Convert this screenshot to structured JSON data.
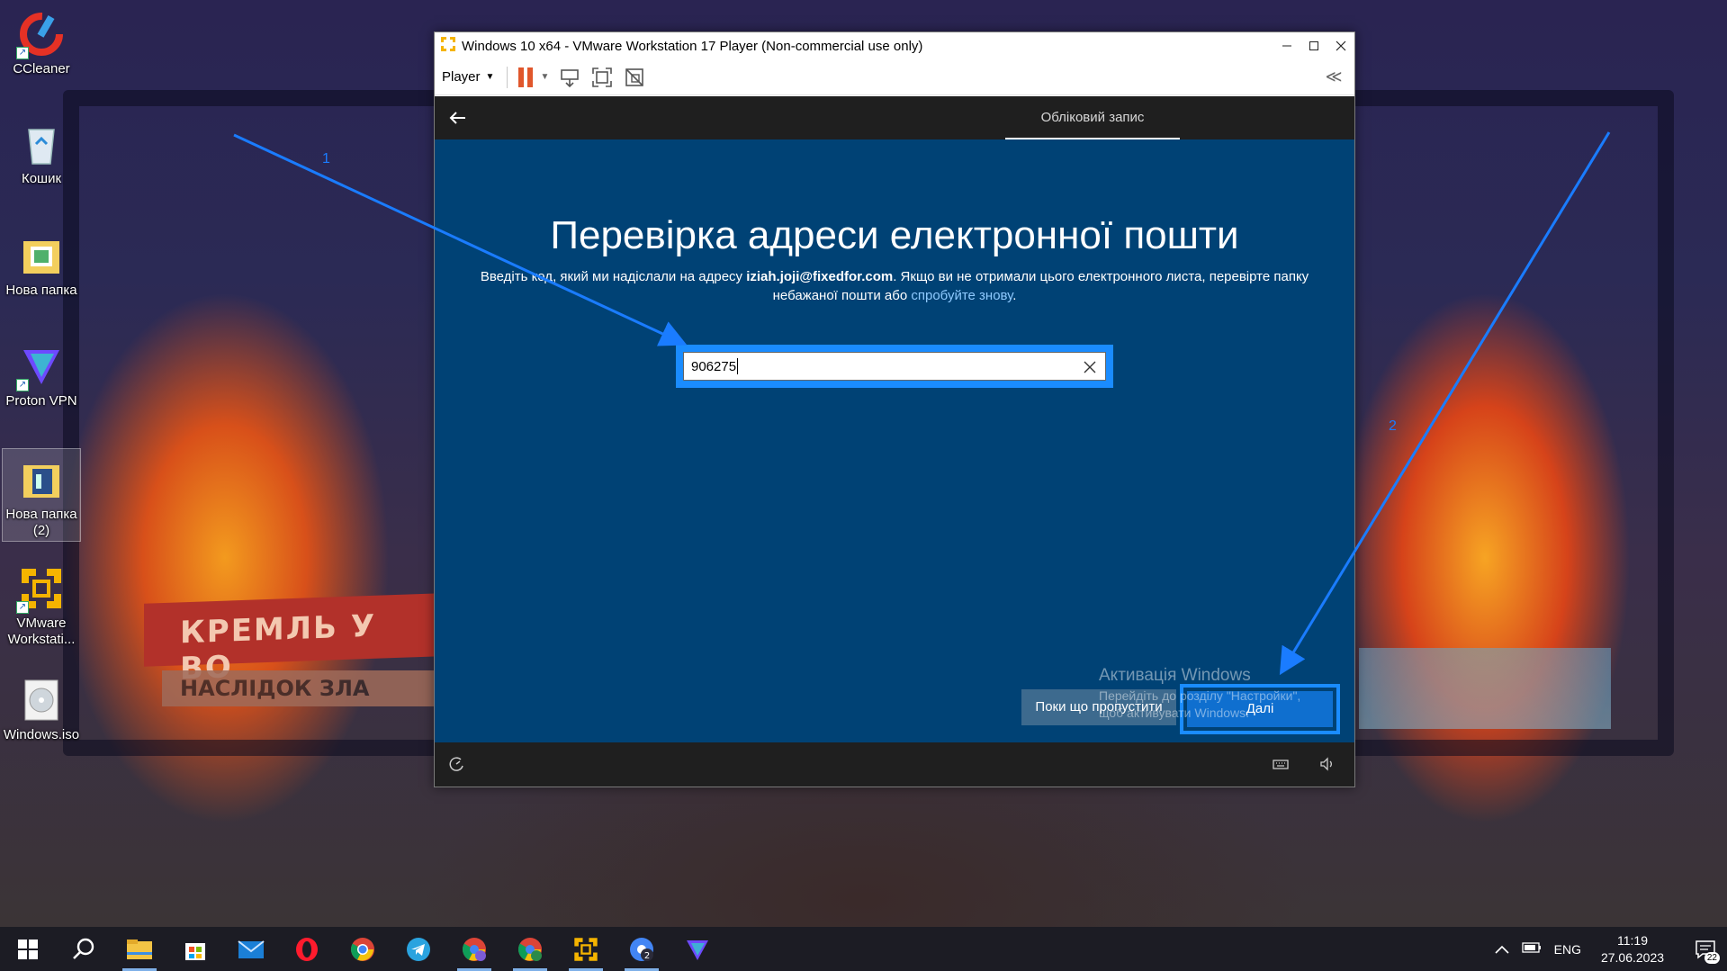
{
  "desktop": {
    "icons": [
      {
        "label": "CCleaner",
        "icon": "ccleaner-icon"
      },
      {
        "label": "Кошик",
        "icon": "recycle-bin-icon"
      },
      {
        "label": "Нова папка",
        "icon": "folder-icon"
      },
      {
        "label": "Proton VPN",
        "icon": "protonvpn-icon"
      },
      {
        "label": "Нова папка\n(2)",
        "icon": "folder-icon"
      },
      {
        "label": "VMware\nWorkstati...",
        "icon": "vmware-icon"
      },
      {
        "label": "Windows.iso",
        "icon": "disc-image-icon"
      }
    ],
    "wallpaper_text": [
      "КРЕМЛЬ У ВО",
      "НАСЛІДОК ЗЛА"
    ]
  },
  "vmware": {
    "title": "Windows 10 x64 - VMware Workstation 17 Player (Non-commercial use only)",
    "menu_label": "Player",
    "collapse_glyph": "≪"
  },
  "guest": {
    "tab_label": "Обліковий запис",
    "heading": "Перевірка адреси електронної пошти",
    "desc_before": "Введіть код, який ми надіслали на адресу ",
    "email": "iziah.joji@fixedfor.com",
    "desc_after": ". Якщо ви не отримали цього електронного листа, перевірте папку небажаної пошти або ",
    "retry_link": "спробуйте знову",
    "desc_end": ".",
    "code_value": "906275",
    "skip_label": "Поки що пропустити",
    "next_label": "Далі",
    "activation_title": "Активація Windows",
    "activation_text": "Перейдіть до розділу \"Настройки\", щоб активувати Windows."
  },
  "annotations": {
    "label_1": "1",
    "label_2": "2",
    "color": "#1a7cff"
  },
  "taskbar": {
    "apps": [
      "start-icon",
      "search-icon",
      "file-explorer-icon",
      "store-icon",
      "mail-icon",
      "opera-icon",
      "chrome-icon",
      "telegram-icon",
      "chrome-profile-icon",
      "chrome-profile-j-icon",
      "vmware-icon",
      "chrome-profile-2-icon",
      "protonvpn-icon"
    ],
    "language": "ENG",
    "time": "11:19",
    "date": "27.06.2023",
    "notifications": "22"
  }
}
